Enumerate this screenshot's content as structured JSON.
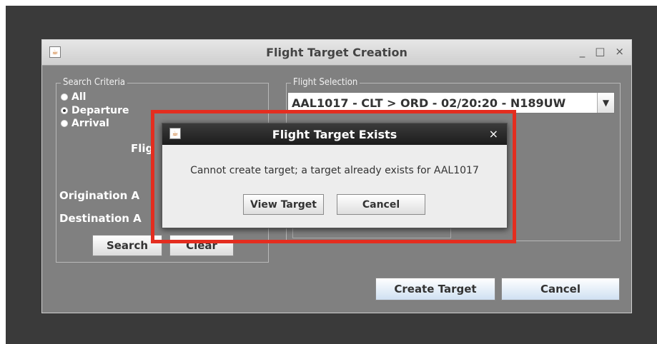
{
  "main_window": {
    "title": "Flight Target Creation",
    "controls": {
      "minimize": "_",
      "maximize": "□",
      "close": "×"
    }
  },
  "search_criteria": {
    "title": "Search Criteria",
    "options": [
      {
        "label": "All",
        "checked": false
      },
      {
        "label": "Departure",
        "checked": true
      },
      {
        "label": "Arrival",
        "checked": false
      }
    ],
    "flight_label_partial": "Flig",
    "origination_label_partial": "Origination A",
    "destination_label_partial": "Destination A",
    "search_button": "Search",
    "clear_button_partial": "Clear"
  },
  "flight_selection": {
    "title": "Flight Selection",
    "selected": "AAL1017 - CLT > ORD - 02/20:20 - N189UW"
  },
  "footer_buttons": {
    "create": "Create Target",
    "cancel": "Cancel"
  },
  "dialog": {
    "title": "Flight Target Exists",
    "close": "×",
    "message": "Cannot create target; a target already exists for AAL1017",
    "view_button": "View Target",
    "cancel_button": "Cancel"
  },
  "colors": {
    "highlight": "#e42d1f",
    "window_bg": "#808080",
    "dialog_titlebar": "#1c1c1c"
  }
}
